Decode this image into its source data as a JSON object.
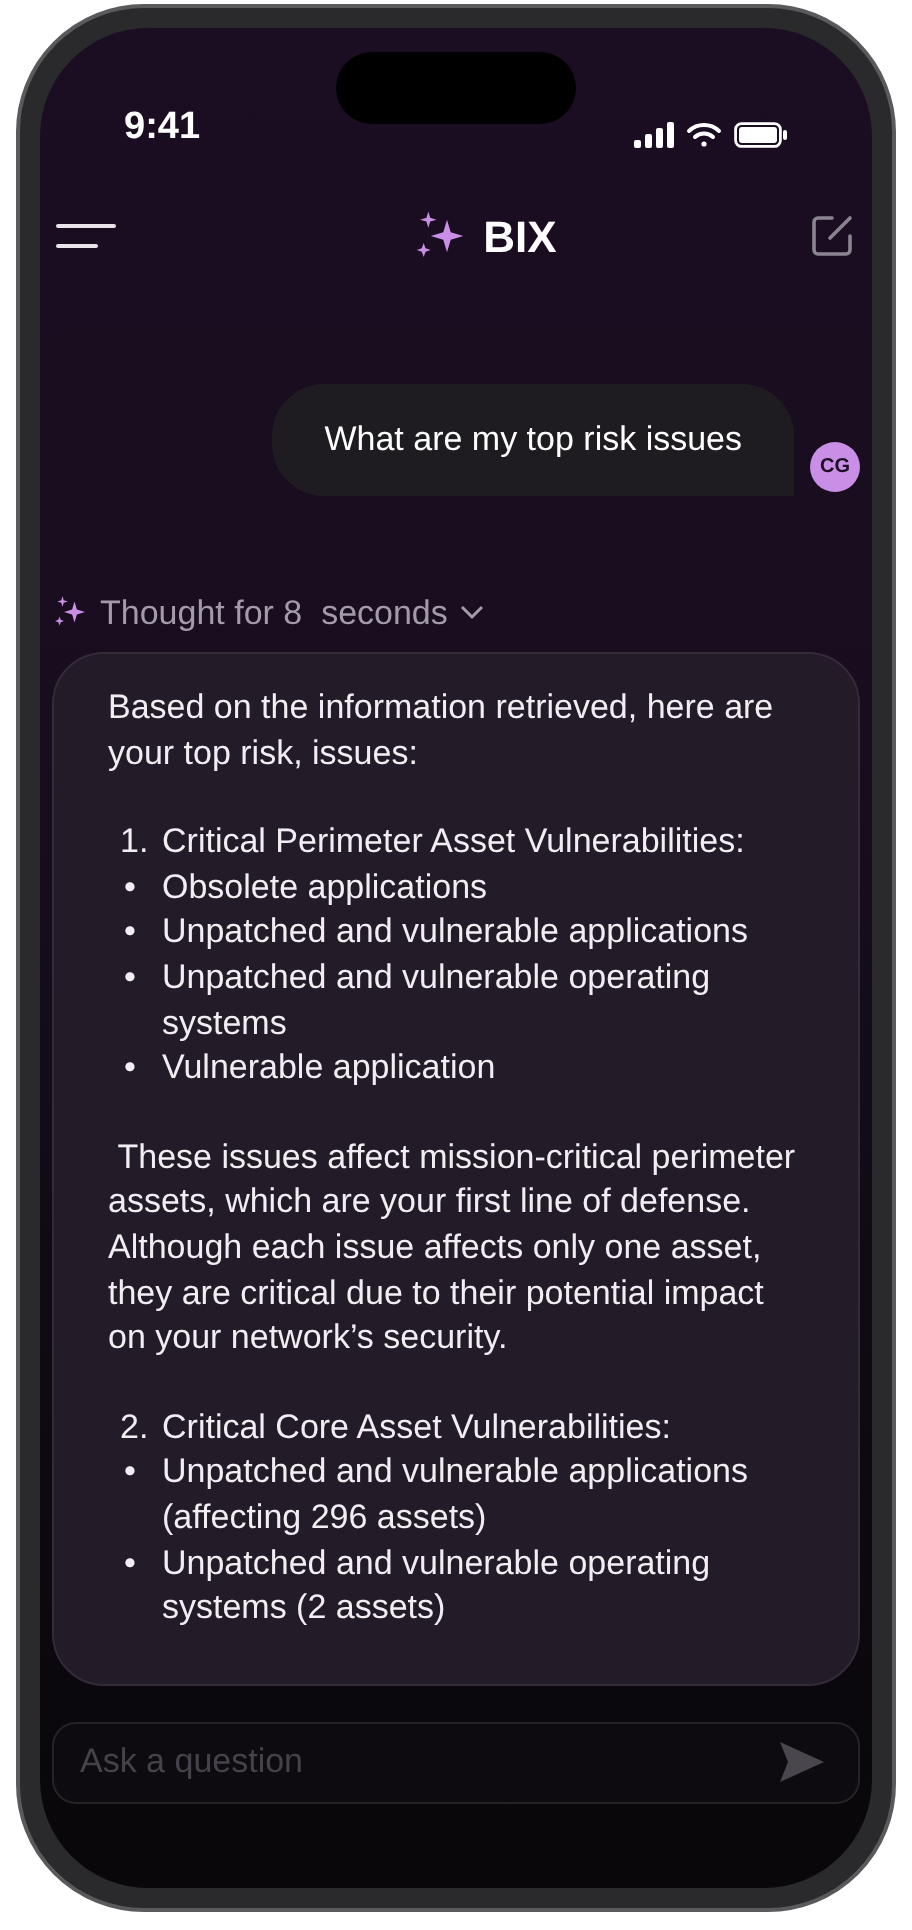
{
  "status_bar": {
    "time": "9:41"
  },
  "header": {
    "title": "BIX"
  },
  "user_message": {
    "text": "What are my top risk issues",
    "avatar": "CG"
  },
  "thought": {
    "label": "Thought for 8  seconds",
    "expanded": false
  },
  "response": {
    "blocks": [
      {
        "kind": "paragraph",
        "text": "Based on the information retrieved, here are your top risk, issues:"
      },
      {
        "kind": "heading",
        "number": "1.",
        "text": "Critical Perimeter Asset Vulnerabilities:"
      },
      {
        "kind": "bullet",
        "marker": "•",
        "text": "Obsolete applications"
      },
      {
        "kind": "bullet",
        "marker": "•",
        "text": "Unpatched and vulnerable applications"
      },
      {
        "kind": "bullet",
        "marker": "•",
        "text": "Unpatched and vulnerable operating systems"
      },
      {
        "kind": "bullet",
        "marker": "•",
        "text": "Vulnerable application"
      },
      {
        "kind": "paragraph",
        "text": " These issues affect mission-critical perimeter assets, which are your first line of defense. Although each issue affects only one asset, they are critical due to their potential impact on your network’s security."
      },
      {
        "kind": "heading",
        "number": "2.",
        "text": "Critical Core Asset Vulnerabilities:"
      },
      {
        "kind": "bullet",
        "marker": "•",
        "text": "Unpatched and vulnerable applications (affecting 296 assets)"
      },
      {
        "kind": "bullet",
        "marker": "•",
        "text": "Unpatched and vulnerable operating systems (2 assets)"
      }
    ]
  },
  "composer": {
    "placeholder": "Ask a question"
  }
}
